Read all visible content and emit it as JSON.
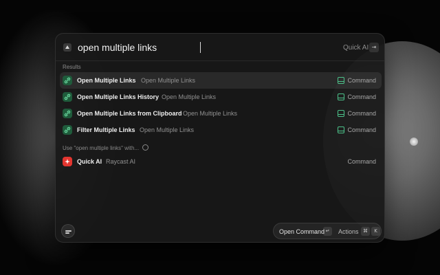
{
  "search": {
    "query": "open multiple links",
    "quick_ai_label": "Quick AI",
    "tab_key": "⇥"
  },
  "sections": {
    "results_label": "Results",
    "use_label": "Use \"open multiple links\" with..."
  },
  "results": [
    {
      "title": "Open Multiple Links",
      "subtitle": "Open Multiple Links",
      "accessory": "Command",
      "icon": "link-icon",
      "selected": true
    },
    {
      "title": "Open Multiple Links History",
      "subtitle": "Open Multiple Links",
      "accessory": "Command",
      "icon": "link-icon",
      "selected": false
    },
    {
      "title": "Open Multiple Links from Clipboard",
      "subtitle": "Open Multiple Links",
      "accessory": "Command",
      "icon": "link-icon",
      "selected": false
    },
    {
      "title": "Filter Multiple Links",
      "subtitle": "Open Multiple Links",
      "accessory": "Command",
      "icon": "link-icon",
      "selected": false
    }
  ],
  "use_with": [
    {
      "title": "Quick AI",
      "subtitle": "Raycast AI",
      "accessory": "Command",
      "icon": "sparkle-icon"
    }
  ],
  "footer": {
    "primary_action": "Open Command",
    "primary_key": "↵",
    "actions_label": "Actions",
    "actions_keys": [
      "⌘",
      "K"
    ]
  },
  "colors": {
    "accent_green": "#4cc38a",
    "link_icon_bg": "#1f5b3b",
    "ai_icon_bg": "#e3352f"
  }
}
